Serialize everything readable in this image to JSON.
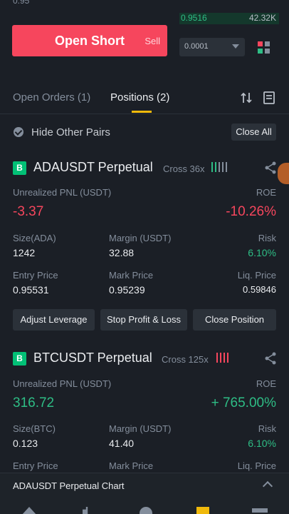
{
  "top": {
    "prev_price": "0.95",
    "book_price": "0.9516",
    "book_qty": "42.32K"
  },
  "order_form": {
    "open_short_label": "Open Short",
    "open_short_sub": "Sell",
    "precision_value": "0.0001"
  },
  "tabs": {
    "orders": "Open Orders (1)",
    "positions": "Positions (2)"
  },
  "filter": {
    "hide_label": "Hide Other Pairs",
    "close_all_label": "Close All"
  },
  "positions": [
    {
      "badge": "B",
      "pair": "ADAUSDT Perpetual",
      "cross": "Cross 36x",
      "pnl_label": "Unrealized PNL (USDT)",
      "roe_label": "ROE",
      "pnl": "-3.37",
      "roe": "-10.26%",
      "size_label": "Size(ADA)",
      "size": "1242",
      "margin_label": "Margin (USDT)",
      "margin": "32.88",
      "risk_label": "Risk",
      "risk": "6.10%",
      "entry_label": "Entry Price",
      "entry": "0.95531",
      "mark_label": "Mark Price",
      "mark": "0.95239",
      "liq_label": "Liq. Price",
      "liq": "0.59846",
      "btn_leverage": "Adjust Leverage",
      "btn_tpsl": "Stop Profit & Loss",
      "btn_close": "Close Position"
    },
    {
      "badge": "B",
      "pair": "BTCUSDT Perpetual",
      "cross": "Cross 125x",
      "pnl_label": "Unrealized PNL (USDT)",
      "roe_label": "ROE",
      "pnl": "316.72",
      "roe": "+ 765.00%",
      "size_label": "Size(BTC)",
      "size": "0.123",
      "margin_label": "Margin (USDT)",
      "margin": "41.40",
      "risk_label": "Risk",
      "risk": "6.10%",
      "entry_label": "Entry Price",
      "mark_label": "Mark Price",
      "liq_label": "Liq. Price"
    }
  ],
  "chart_bar": {
    "label": "ADAUSDT Perpetual  Chart"
  },
  "colors": {
    "short": "#f6465d",
    "long": "#2ebd85",
    "accent": "#f0b90b",
    "background": "#1b1f26"
  }
}
